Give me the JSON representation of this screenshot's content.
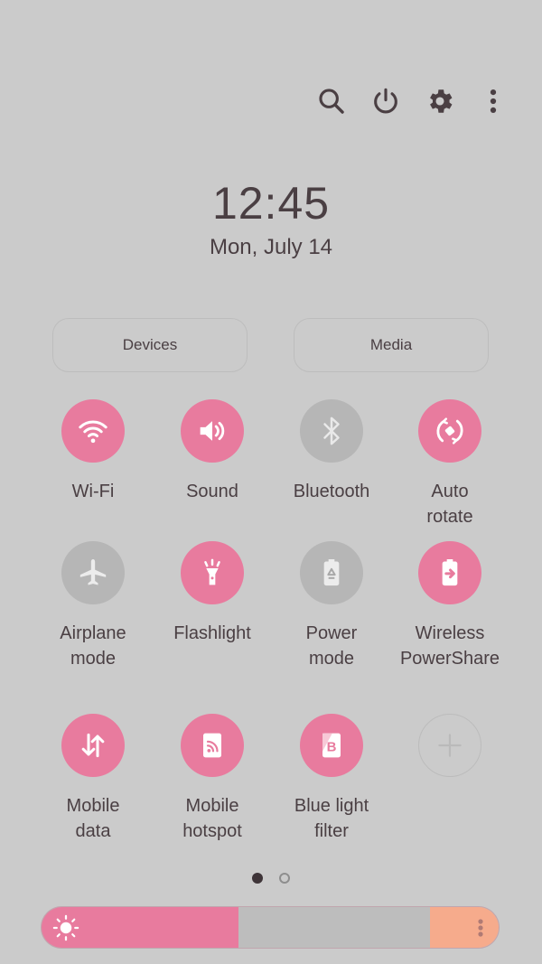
{
  "header": {
    "icons": [
      {
        "name": "search-icon",
        "label": "Search"
      },
      {
        "name": "power-icon",
        "label": "Power"
      },
      {
        "name": "gear-icon",
        "label": "Settings"
      },
      {
        "name": "more-vert-icon",
        "label": "More options"
      }
    ]
  },
  "clock": {
    "time": "12:45",
    "date": "Mon, July 14"
  },
  "shortcuts": {
    "devices_label": "Devices",
    "media_label": "Media"
  },
  "tiles": [
    {
      "label": "Wi-Fi",
      "icon": "wifi-icon",
      "state": "on"
    },
    {
      "label": "Sound",
      "icon": "speaker-icon",
      "state": "on"
    },
    {
      "label": "Bluetooth",
      "icon": "bluetooth-icon",
      "state": "off"
    },
    {
      "label": "Auto\nrotate",
      "icon": "rotate-icon",
      "state": "on"
    },
    {
      "label": "Airplane\nmode",
      "icon": "airplane-icon",
      "state": "off"
    },
    {
      "label": "Flashlight",
      "icon": "flashlight-icon",
      "state": "on"
    },
    {
      "label": "Power\nmode",
      "icon": "battery-recycle-icon",
      "state": "off"
    },
    {
      "label": "Wireless\nPowerShare",
      "icon": "battery-share-icon",
      "state": "on"
    },
    {
      "label": "Mobile\ndata",
      "icon": "data-arrows-icon",
      "state": "on"
    },
    {
      "label": "Mobile\nhotspot",
      "icon": "hotspot-icon",
      "state": "on"
    },
    {
      "label": "Blue light\nfilter",
      "icon": "blue-light-filter-icon",
      "state": "on"
    },
    {
      "label": "",
      "icon": "plus-icon",
      "state": "add"
    }
  ],
  "pager": {
    "current_page": 1,
    "total_pages": 2
  },
  "brightness": {
    "level_percent": 43,
    "icon": "sun-icon",
    "more_icon": "more-vert-icon"
  },
  "colors": {
    "accent_on": "#e87b9e",
    "tile_off": "#b6b6b6",
    "background": "#cbcbcb",
    "text": "#4a3f43",
    "brightness_end": "#f6ab8c"
  }
}
